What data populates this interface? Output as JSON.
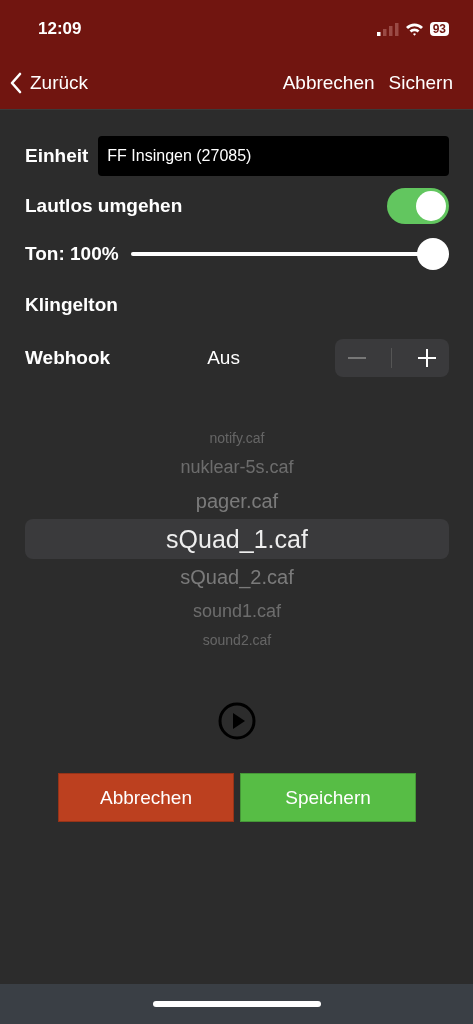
{
  "status_bar": {
    "time": "12:09",
    "battery": "93"
  },
  "nav": {
    "back": "Zurück",
    "actions": [
      "Abbrechen",
      "Sichern"
    ]
  },
  "unit": {
    "label": "Einheit",
    "value": "FF Insingen (27085)"
  },
  "silent": {
    "label": "Lautlos umgehen",
    "on": true
  },
  "volume": {
    "label": "Ton: 100%",
    "level": 1
  },
  "ringtone": {
    "label": "Klingelton"
  },
  "webhook": {
    "label": "Webhook",
    "value": "Aus"
  },
  "picker": [
    {
      "label": "notify.caf",
      "selected": false
    },
    {
      "label": "nuklear-5s.caf",
      "selected": false
    },
    {
      "label": "pager.caf",
      "selected": false
    },
    {
      "label": "sQuad_1.caf",
      "selected": true
    },
    {
      "label": "sQuad_2.caf",
      "selected": false
    },
    {
      "label": "sound1.caf",
      "selected": false
    },
    {
      "label": "sound2.caf",
      "selected": false
    }
  ],
  "buttons": [
    {
      "label": "Abbrechen",
      "kind": "cancel"
    },
    {
      "label": "Speichern",
      "kind": "save"
    }
  ]
}
